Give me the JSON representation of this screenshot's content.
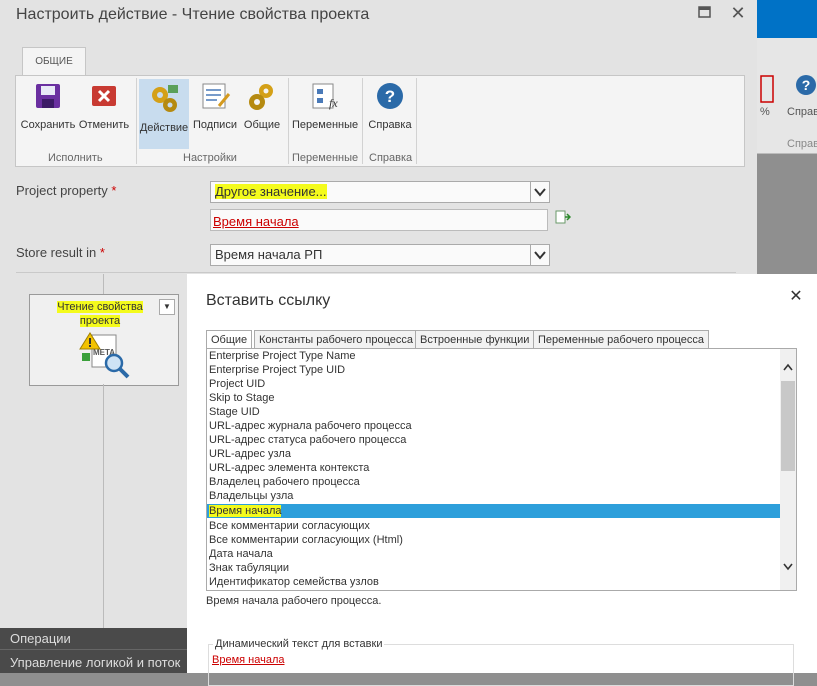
{
  "dialog": {
    "title": "Настроить действие - Чтение свойства проекта",
    "tab": "ОБЩИЕ",
    "ribbon": {
      "buttons": {
        "save": "Сохранить",
        "cancel": "Отменить",
        "action": "Действие",
        "labels": "Подписи",
        "general": "Общие",
        "variables": "Переменные",
        "help": "Справка"
      },
      "groups": {
        "execute": "Исполнить",
        "settings": "Настройки",
        "variables": "Переменные",
        "help": "Справка"
      }
    },
    "fields": {
      "project_property": {
        "label": "Project property",
        "required": "*",
        "value": "Другое значение...",
        "link": "Время начала"
      },
      "store_result": {
        "label": "Store result in",
        "required": "*",
        "value": "Время начала РП"
      }
    },
    "shape": {
      "title": "Чтение свойства проекта"
    }
  },
  "background": {
    "ribbon_percent": "%",
    "ribbon_help": "Справ",
    "ribbon_help_group": "Справ",
    "sidebar": [
      "Операции",
      "Управление логикой и поток"
    ]
  },
  "popup": {
    "title": "Вставить ссылку",
    "tabs": [
      "Общие",
      "Константы рабочего процесса",
      "Встроенные функции",
      "Переменные рабочего процесса"
    ],
    "items": [
      "Enterprise Project Type Name",
      "Enterprise Project Type UID",
      "Project UID",
      "Skip to Stage",
      "Stage UID",
      "URL-адрес журнала рабочего процесса",
      "URL-адрес статуса рабочего процесса",
      "URL-адрес узла",
      "URL-адрес элемента контекста",
      "Владелец рабочего процесса",
      "Владельцы узла",
      "Время начала",
      "Все комментарии согласующих",
      "Все комментарии согласующих (Html)",
      "Дата начала",
      "Знак табуляции",
      "Идентификатор семейства узлов"
    ],
    "selected_item": "Время начала",
    "description": "Время начала рабочего процесса.",
    "dynamic_label": "Динамический текст для вставки",
    "dynamic_value": "Время начала"
  },
  "colors": {
    "accent": "#0072c6",
    "highlight": "#f4fb1c",
    "selection": "#2d9fdb",
    "link": "#cc0000"
  }
}
